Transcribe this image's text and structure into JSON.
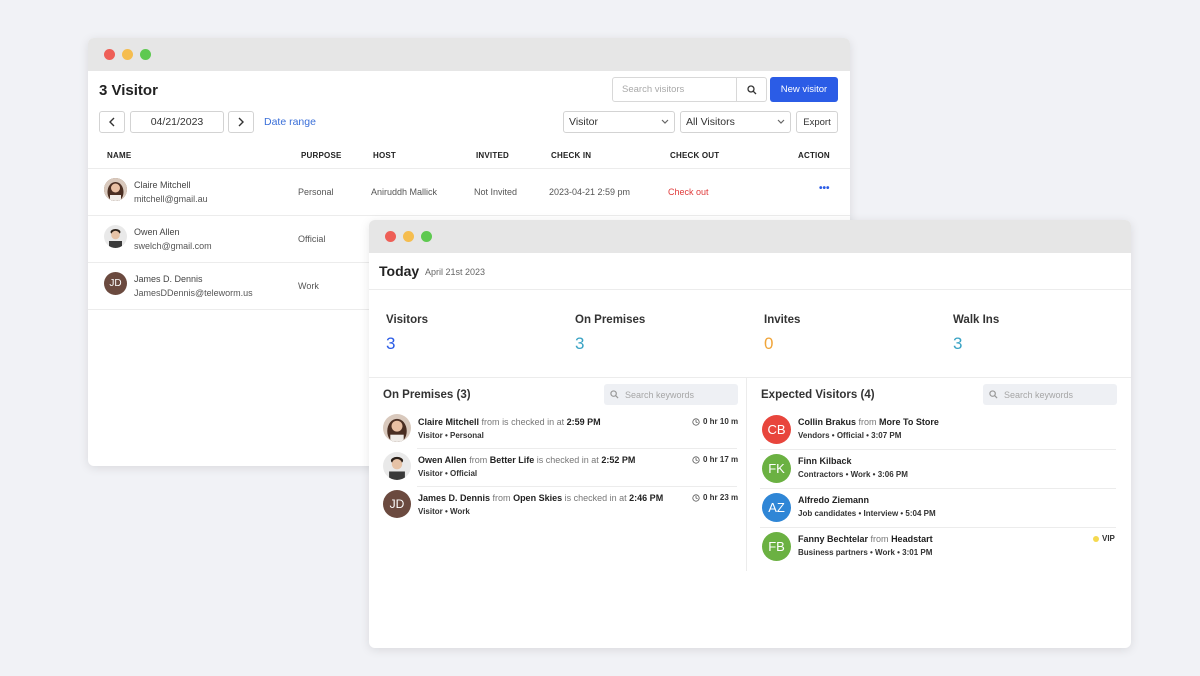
{
  "colors": {
    "window_close": "#ee5f57",
    "window_minimize": "#f5bd4f",
    "window_maximize": "#5ec950",
    "primary": "#2b5ce6",
    "danger": "#e03b3b",
    "visitors_stat": "#2b5ce6",
    "on_premises_stat": "#3aa3c4",
    "invites_stat": "#f0a53a",
    "walkins_stat": "#3aa3c4"
  },
  "visitor_list": {
    "title": "3 Visitor",
    "search_placeholder": "Search visitors",
    "new_button": "New visitor",
    "prev_icon": "chevron-left-icon",
    "next_icon": "chevron-right-icon",
    "date": "04/21/2023",
    "date_range": "Date range",
    "type_filter": "Visitor",
    "status_filter": "All Visitors",
    "export": "Export",
    "columns": [
      "NAME",
      "PURPOSE",
      "HOST",
      "INVITED",
      "CHECK IN",
      "CHECK OUT",
      "ACTION"
    ],
    "rows": [
      {
        "name": "Claire Mitchell",
        "email": "mitchell@gmail.au",
        "purpose": "Personal",
        "host": "Aniruddh Mallick",
        "invited": "Not Invited",
        "check_in": "2023-04-21 2:59 pm",
        "check_out": "Check out",
        "action": "•••"
      },
      {
        "name": "Owen Allen",
        "email": "swelch@gmail.com",
        "purpose": "Official"
      },
      {
        "name": "James D. Dennis",
        "initials": "JD",
        "email": "JamesDDennis@teleworm.us",
        "purpose": "Work"
      }
    ]
  },
  "today": {
    "title": "Today",
    "date": "April 21st 2023",
    "stats": [
      {
        "label": "Visitors",
        "value": "3"
      },
      {
        "label": "On Premises",
        "value": "3"
      },
      {
        "label": "Invites",
        "value": "0"
      },
      {
        "label": "Walk Ins",
        "value": "3"
      }
    ],
    "on_premises": {
      "title": "On Premises (3)",
      "search_placeholder": "Search keywords",
      "items": [
        {
          "name": "Claire Mitchell",
          "from_word": "from",
          "company": "",
          "checked_text": "is checked in at",
          "time": "2:59 PM",
          "sub": "Visitor • Personal",
          "duration": "0 hr 10 m"
        },
        {
          "name": "Owen Allen",
          "from_word": "from",
          "company": "Better Life",
          "checked_text": "is checked in at",
          "time": "2:52 PM",
          "sub": "Visitor • Official",
          "duration": "0 hr 17 m"
        },
        {
          "name": "James D. Dennis",
          "initials": "JD",
          "from_word": "from",
          "company": "Open Skies",
          "checked_text": "is checked in at",
          "time": "2:46 PM",
          "sub": "Visitor • Work",
          "duration": "0 hr 23 m"
        }
      ]
    },
    "expected": {
      "title": "Expected Visitors (4)",
      "search_placeholder": "Search keywords",
      "items": [
        {
          "initials": "CB",
          "color": "#e8453c",
          "name": "Collin Brakus",
          "from_word": "from",
          "company": "More To Store",
          "sub": "Vendors • Official • 3:07 PM"
        },
        {
          "initials": "FK",
          "color": "#6bb142",
          "name": "Finn Kilback",
          "from_word": "",
          "company": "",
          "sub": "Contractors • Work • 3:06 PM"
        },
        {
          "initials": "AZ",
          "color": "#2f86d6",
          "name": "Alfredo Ziemann",
          "from_word": "",
          "company": "",
          "sub": "Job candidates • Interview • 5:04 PM"
        },
        {
          "initials": "FB",
          "color": "#6bb142",
          "name": "Fanny Bechtelar",
          "from_word": "from",
          "company": "Headstart",
          "sub": "Business partners • Work • 3:01 PM",
          "badge": "VIP"
        }
      ]
    }
  }
}
